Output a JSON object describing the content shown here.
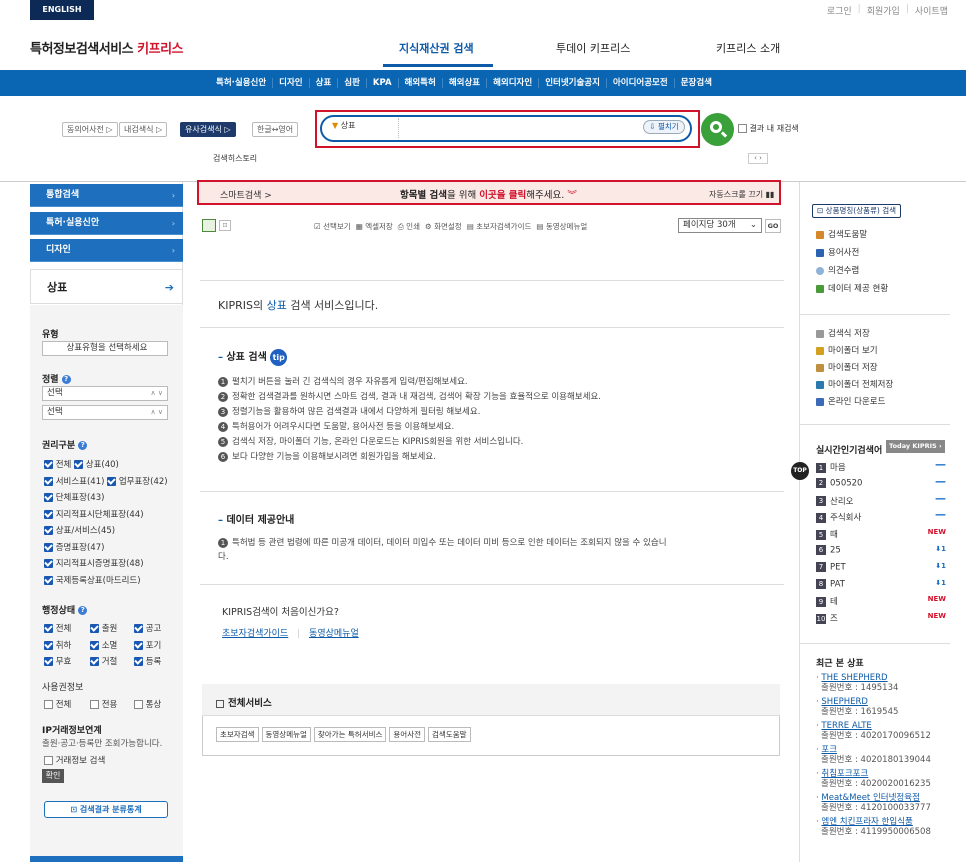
{
  "header": {
    "lang_button": "ENGLISH",
    "top_links": [
      "로그인",
      "회원가입",
      "사이트맵"
    ],
    "logo_main": "특허정보검색서비스 ",
    "logo_brand": "키프리스",
    "main_nav": [
      "지식재산권 검색",
      "투데이 키프리스",
      "키프리스 소개"
    ]
  },
  "subnav": [
    "특허·실용신안",
    "디자인",
    "상표",
    "심판",
    "KPA",
    "해외특허",
    "해외상표",
    "해외디자인",
    "인터넷기술공지",
    "아이디어공모전",
    "문장검색"
  ],
  "search": {
    "left_buttons": [
      "동의어사전 ▷",
      "내검색식 ▷",
      "유사검색식 ▷",
      "한글↔영어"
    ],
    "select_label": "상표",
    "select_arrow": "▼",
    "expand_label": "⇩ 펼치기",
    "research_label": "결과 내 재검색",
    "history_label": "검색히스토리",
    "pager_label": "‹ ›"
  },
  "sidebar": {
    "items": [
      "통합검색",
      "특허·실용신안",
      "디자인"
    ],
    "active_item": "상표",
    "arrow": "›",
    "active_arrow": "➔",
    "type_label": "유형",
    "type_select": "상표유형을 선택하세요",
    "sort_label": "정렬",
    "sort_select1": "선택",
    "sort_select2": "선택",
    "rights_label": "권리구분",
    "rights_options": [
      [
        "전체",
        "상표(40)"
      ],
      [
        "서비스표(41)",
        "업무표장(42)"
      ],
      [
        "단체표장(43)"
      ],
      [
        "지리적표시단체표장(44)"
      ],
      [
        "상표/서비스(45)"
      ],
      [
        "증명표장(47)"
      ],
      [
        "지리적표시증명표장(48)"
      ],
      [
        "국제등록상표(마드리드)"
      ]
    ],
    "status_label": "행정상태",
    "status_options": [
      [
        "전체",
        "출원",
        "공고"
      ],
      [
        "취하",
        "소멸",
        "포기"
      ],
      [
        "무효",
        "거절",
        "등록"
      ]
    ],
    "license_label": "사용권정보",
    "license_options": [
      "전체",
      "전용",
      "통상"
    ],
    "ip_label": "IP거래정보연계",
    "ip_desc": "출원·공고·등록만 조회가능합니다.",
    "ip_check": "거래정보 검색",
    "confirm_btn": "확인",
    "stats_btn": "⊡ 검색결과 분류통계",
    "ud": "∧ ∨",
    "q": "?"
  },
  "smart": {
    "left": "스마트검색 >",
    "mid_a": "항목별 검색",
    "mid_b": "을 위해 ",
    "mid_c": "이곳을 클릭",
    "mid_d": "해주세요.",
    "chev": "︾",
    "right": "자동스크롤 끄기 ▮▮"
  },
  "toolbar": {
    "items": [
      "☑ 선택보기",
      "▦ 엑셀저장",
      "⎙ 인쇄",
      "⚙ 화면설정",
      "▤ 초보자검색가이드",
      "▤ 동영상메뉴얼"
    ],
    "perpage": "페이지당 30개",
    "go": "GO",
    "icon2": "⊡"
  },
  "main": {
    "intro_a": "KIPRIS의 ",
    "intro_b": "상표",
    "intro_c": " 검색 서비스입니다.",
    "sec1_title": "상표 검색",
    "tip": "tip",
    "dash": "–",
    "sec1_items": [
      "펼치기 버튼을 눌러 긴 검색식의 경우 자유롭게 입력/편집해보세요.",
      "정확한 검색결과를 원하시면 스마트 검색, 결과 내 재검색, 검색어 확장 기능을 효율적으로 이용해보세요.",
      "정렬기능을 활용하여 많은 검색결과 내에서 다양하게 필터링 해보세요.",
      "특허용어가 어려우시다면 도움말, 용어사전 등을 이용해보세요.",
      "검색식 저장, 마이폴더 기능, 온라인 다운로드는 KIPRIS회원을 위한 서비스입니다.",
      "보다 다양한 기능을 이용해보시려면 회원가입을 해보세요."
    ],
    "sec2_title": "데이터 제공안내",
    "sec2_item_a": "특허법 등 관련 법령에 따른 미공개 데이터, 데이터 미입수 또는 데이터 미비 등으로 인한 데이터는 조회되지 않을 수 있습니",
    "sec2_item_b": "다.",
    "first_q": "KIPRIS검색이 처음이신가요?",
    "guide_links": [
      "초보자검색가이드",
      "동영상메뉴얼"
    ],
    "sep": "|",
    "svc_title": "전체서비스",
    "svc_buttons": [
      "초보자검색",
      "동영상메뉴얼",
      "찾아가는 특허서비스",
      "용어사전",
      "검색도움말"
    ]
  },
  "right": {
    "badge": "⊡ 상품명칭(상품류) 검색",
    "links1": [
      "검색도움말",
      "용어사전",
      "의견수렴",
      "데이터 제공 현황"
    ],
    "links2": [
      "검색식 저장",
      "마이폴더 보기",
      "마이폴더 저장",
      "마이폴더 전체저장",
      "온라인 다운로드"
    ],
    "realtime_title": "실시간인기검색어",
    "today_badge": "Today KIPRIS ›",
    "top_badge": "TOP",
    "ranks": [
      {
        "n": "1",
        "term": "마음",
        "change": "—"
      },
      {
        "n": "2",
        "term": "050520",
        "change": "—"
      },
      {
        "n": "3",
        "term": "산리오",
        "change": "—"
      },
      {
        "n": "4",
        "term": "주식회사",
        "change": "—"
      },
      {
        "n": "5",
        "term": "때",
        "change": "NEW"
      },
      {
        "n": "6",
        "term": "25",
        "change": "⬇1"
      },
      {
        "n": "7",
        "term": "PET",
        "change": "⬇1"
      },
      {
        "n": "8",
        "term": "PAT",
        "change": "⬇1"
      },
      {
        "n": "9",
        "term": "테",
        "change": "NEW"
      },
      {
        "n": "10",
        "term": "즈",
        "change": "NEW"
      }
    ],
    "recent_title": "최근 본 상표",
    "recent": [
      {
        "name": "THE SHEPHERD",
        "no": "출원번호 : 1495134"
      },
      {
        "name": "SHEPHERD",
        "no": "출원번호 : 1619545"
      },
      {
        "name": "TERRE ALTE",
        "no": "출원번호 : 4020170096512"
      },
      {
        "name": "포크",
        "no": "출원번호 : 4020180139044"
      },
      {
        "name": "취침포크포크",
        "no": "출원번호 : 4020020016235"
      },
      {
        "name": "Meat&Meet 인터넷정육점",
        "no": "출원번호 : 4120100033777"
      },
      {
        "name": "엠엔 치킨프라자 한입식품",
        "no": "출원번호 : 4119950006508"
      }
    ]
  },
  "colors": {
    "brand_blue": "#0a66b2",
    "brand_red": "#d1122b",
    "nav_dark": "#0d2a57"
  }
}
